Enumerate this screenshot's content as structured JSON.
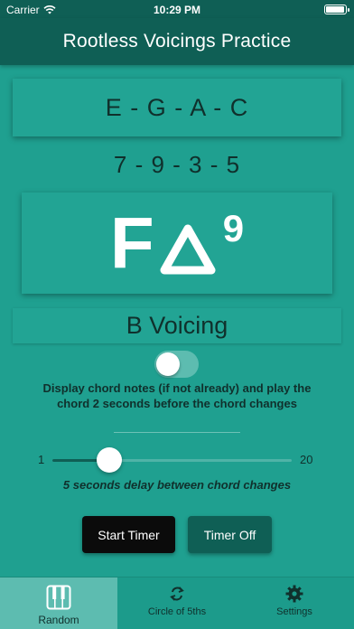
{
  "status_bar": {
    "carrier": "Carrier",
    "time": "10:29 PM"
  },
  "nav": {
    "title": "Rootless Voicings Practice"
  },
  "chord": {
    "notes": "E - G - A - C",
    "intervals": "7 - 9 - 3 - 5",
    "root": "F",
    "quality_symbol": "Δ",
    "extension": "9",
    "voicing": "B Voicing"
  },
  "toggle": {
    "on": false,
    "label": "Display chord notes (if not already) and play the chord 2 seconds before the chord changes"
  },
  "slider": {
    "min": "1",
    "max": "20",
    "value": 5,
    "caption": "5 seconds delay between chord changes"
  },
  "buttons": {
    "start_timer": "Start Timer",
    "timer_off": "Timer Off"
  },
  "tabs": [
    {
      "label": "Random",
      "icon": "piano-icon",
      "selected": true
    },
    {
      "label": "Circle of 5ths",
      "icon": "rotate-arrows-icon",
      "selected": false
    },
    {
      "label": "Settings",
      "icon": "gear-icon",
      "selected": false
    }
  ],
  "colors": {
    "background": "#1fa090",
    "nav": "#0f5f55",
    "start_button": "#0b0b0b",
    "selected_tab": "#5dbcb0"
  }
}
